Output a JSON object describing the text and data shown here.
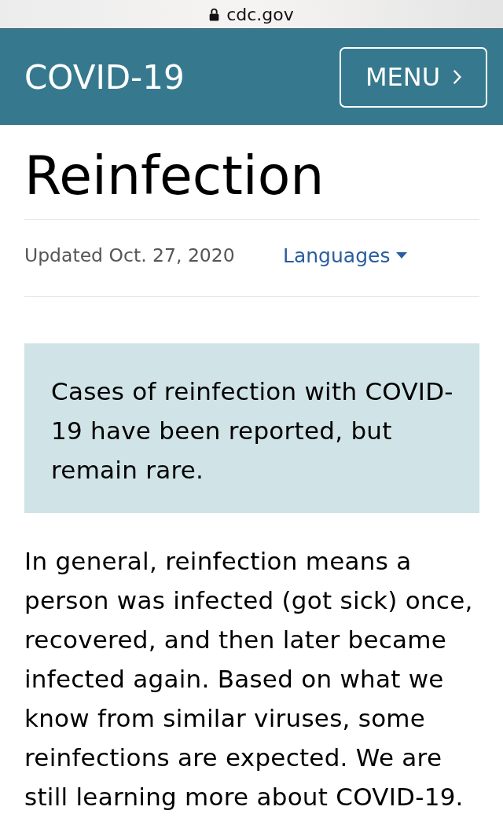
{
  "address_bar": {
    "url": "cdc.gov"
  },
  "header": {
    "title": "COVID-19",
    "menu_button": "MENU"
  },
  "page": {
    "title": "Reinfection",
    "updated": "Updated Oct. 27, 2020",
    "languages_link": "Languages"
  },
  "callout": {
    "text": "Cases of reinfection with COVID-19 have been reported, but remain rare."
  },
  "body": {
    "paragraph": "In general, reinfection means a person was infected (got sick) once, recovered, and then later became infected again. Based on what we know from similar viruses, some reinfections are expected. We are still learning more about COVID-19."
  }
}
